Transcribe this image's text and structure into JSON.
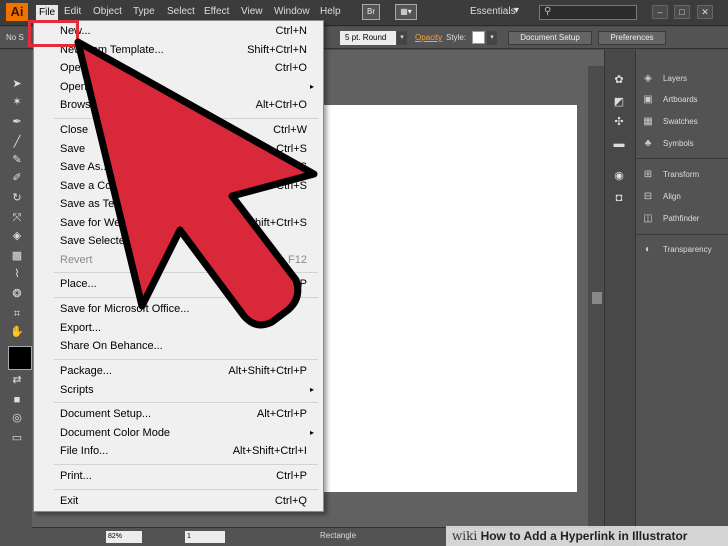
{
  "app": {
    "logo_text": "Ai"
  },
  "menubar": {
    "items": [
      "File",
      "Edit",
      "Object",
      "Type",
      "Select",
      "Effect",
      "View",
      "Window",
      "Help"
    ],
    "br_label": "Br",
    "workspace": "Essentials",
    "search_placeholder": ""
  },
  "controlbar": {
    "no_selection": "No S",
    "stroke_profile": "5 pt. Round",
    "opacity_label": "Opacity",
    "style_label": "Style:",
    "document_setup": "Document Setup",
    "preferences": "Preferences"
  },
  "file_menu": {
    "items": [
      {
        "label": "New...",
        "shortcut": "Ctrl+N"
      },
      {
        "label": "New from Template...",
        "shortcut": "Shift+Ctrl+N"
      },
      {
        "label": "Open...",
        "shortcut": "Ctrl+O"
      },
      {
        "label": "Open Recent Files",
        "shortcut": "",
        "submenu": true
      },
      {
        "label": "Browse in Bridge...",
        "shortcut": "Alt+Ctrl+O"
      },
      {
        "label": "Close",
        "shortcut": "Ctrl+W"
      },
      {
        "label": "Save",
        "shortcut": "Ctrl+S"
      },
      {
        "label": "Save As...",
        "shortcut": "Shift+Ctrl+S"
      },
      {
        "label": "Save a Copy...",
        "shortcut": "Alt+Ctrl+S"
      },
      {
        "label": "Save as Template...",
        "shortcut": ""
      },
      {
        "label": "Save for Web...",
        "shortcut": "Alt+Shift+Ctrl+S"
      },
      {
        "label": "Save Selected Slices...",
        "shortcut": ""
      },
      {
        "label": "Revert",
        "shortcut": "F12",
        "disabled": true
      },
      {
        "label": "Place...",
        "shortcut": "Shift+Ctrl+P"
      },
      {
        "label": "Save for Microsoft Office...",
        "shortcut": ""
      },
      {
        "label": "Export...",
        "shortcut": ""
      },
      {
        "label": "Share On Behance...",
        "shortcut": ""
      },
      {
        "label": "Package...",
        "shortcut": "Alt+Shift+Ctrl+P"
      },
      {
        "label": "Scripts",
        "shortcut": "",
        "submenu": true
      },
      {
        "label": "Document Setup...",
        "shortcut": "Alt+Ctrl+P"
      },
      {
        "label": "Document Color Mode",
        "shortcut": "",
        "submenu": true
      },
      {
        "label": "File Info...",
        "shortcut": "Alt+Shift+Ctrl+I"
      },
      {
        "label": "Print...",
        "shortcut": "Ctrl+P"
      },
      {
        "label": "Exit",
        "shortcut": "Ctrl+Q"
      }
    ]
  },
  "panels": {
    "items": [
      "Layers",
      "Artboards",
      "Swatches",
      "Symbols",
      "Transform",
      "Align",
      "Pathfinder",
      "Transparency"
    ]
  },
  "statusbar": {
    "zoom": "82%",
    "page": "1",
    "tool": "Rectangle"
  },
  "watermark": {
    "site": "wiki",
    "title": "How to Add a Hyperlink in Illustrator"
  },
  "colors": {
    "highlight": "#e12e3b",
    "arrow_fill": "#d8283a",
    "logo": "#f27200"
  }
}
